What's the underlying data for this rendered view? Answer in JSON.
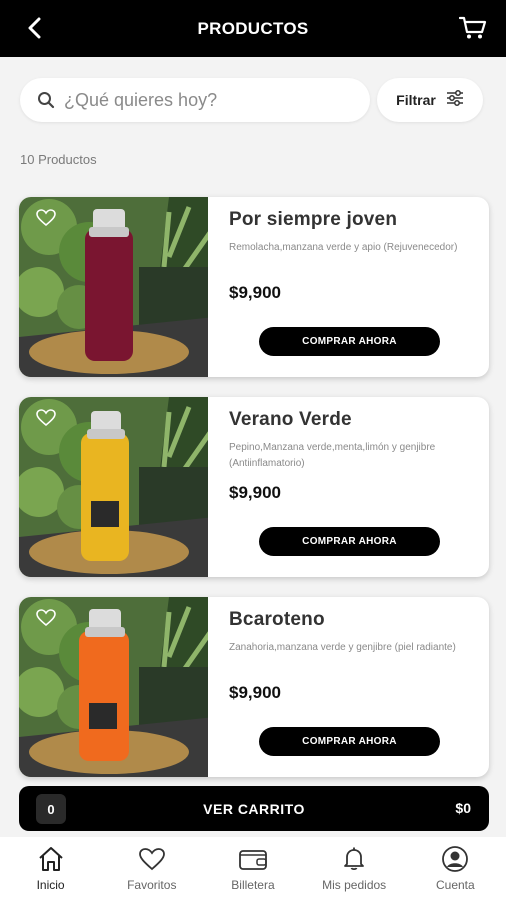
{
  "header": {
    "title": "PRODUCTOS",
    "back_icon": "back-arrow-icon",
    "cart_icon": "cart-icon"
  },
  "search": {
    "placeholder": "¿Qué quieres hoy?",
    "value": "",
    "icon": "search-icon"
  },
  "filter": {
    "label": "Filtrar",
    "icon": "sliders-icon"
  },
  "count_label": "10 Productos",
  "products": [
    {
      "name": "Por siempre joven",
      "description": "Remolacha,manzana verde y apio (Rejuvenecedor)",
      "price": "$9,900",
      "button": "COMPRAR AHORA",
      "juice_color": "#7a1530"
    },
    {
      "name": "Verano Verde",
      "description": "Pepino,Manzana verde,menta,limón y genjibre (Antiinflamatorio)",
      "price": "$9,900",
      "button": "COMPRAR AHORA",
      "juice_color": "#e9b521"
    },
    {
      "name": "Bcaroteno",
      "description": "Zanahoria,manzana verde y genjibre (piel radiante)",
      "price": "$9,900",
      "button": "COMPRAR AHORA",
      "juice_color": "#f06a1e"
    }
  ],
  "cart_bar": {
    "quantity": "0",
    "label": "VER CARRITO",
    "total": "$0"
  },
  "nav": [
    {
      "label": "Inicio",
      "icon": "home-icon"
    },
    {
      "label": "Favoritos",
      "icon": "heart-icon"
    },
    {
      "label": "Billetera",
      "icon": "wallet-icon"
    },
    {
      "label": "Mis pedidos",
      "icon": "bell-icon"
    },
    {
      "label": "Cuenta",
      "icon": "user-icon"
    }
  ]
}
